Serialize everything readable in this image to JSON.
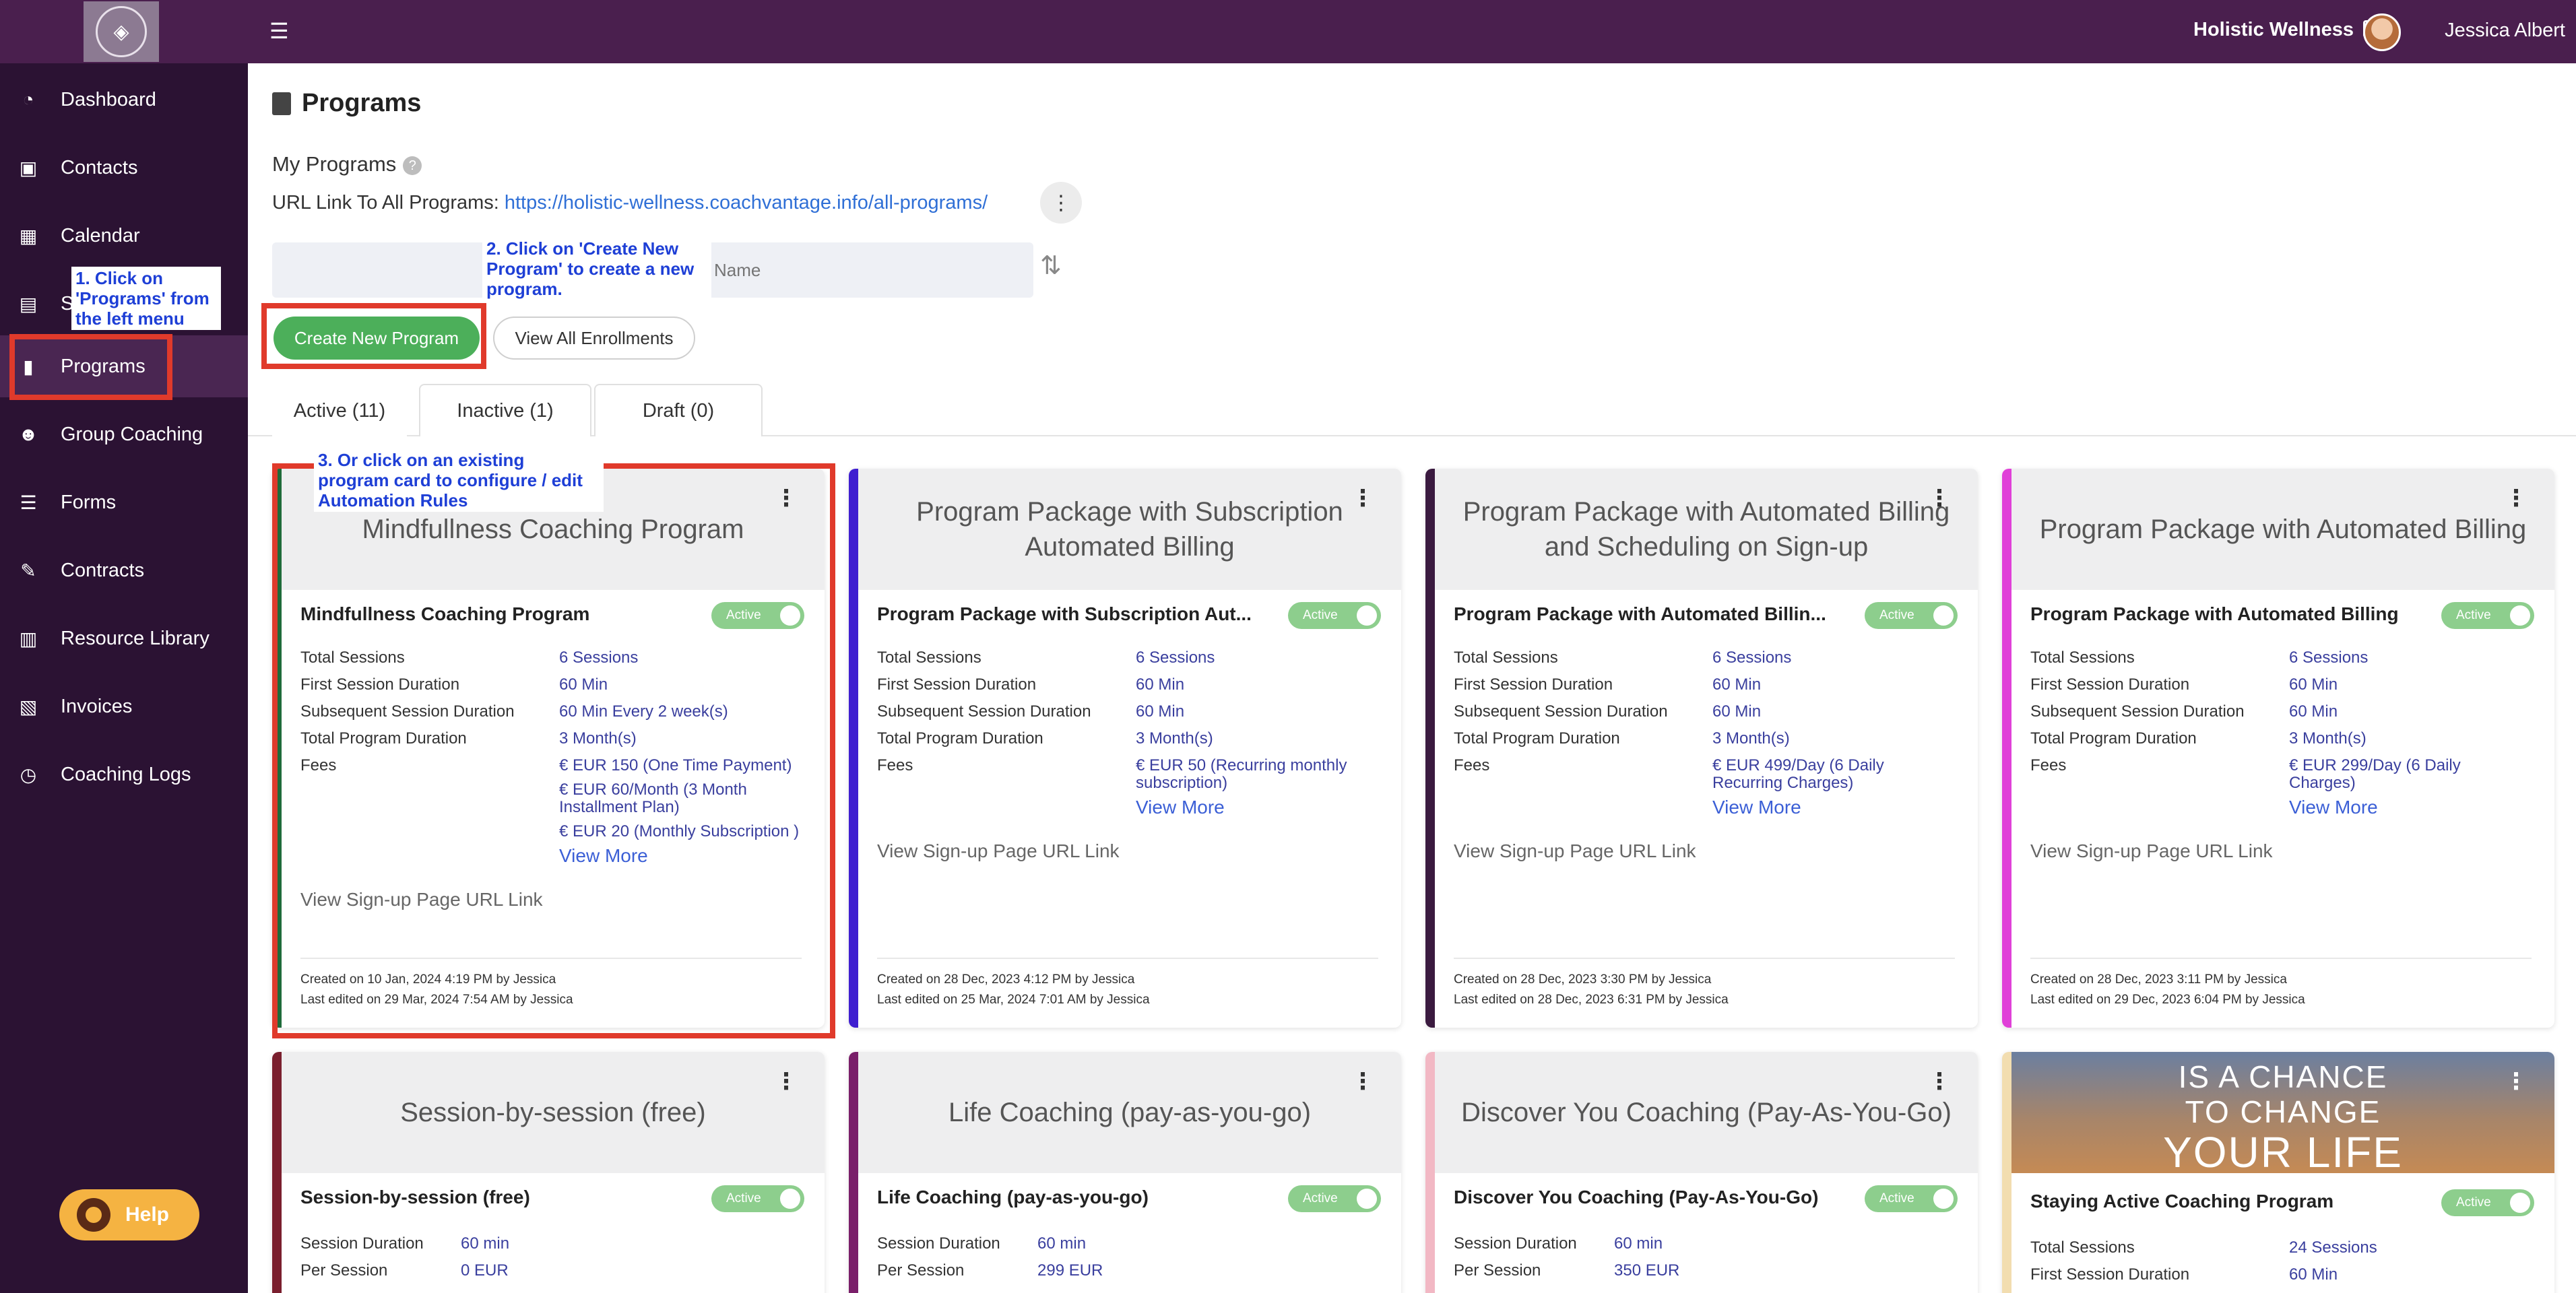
{
  "header": {
    "brand": "Holistic Wellness",
    "username": "Jessica Albert"
  },
  "sidebar": {
    "items": [
      {
        "label": "Dashboard",
        "icon": "dashboard-icon"
      },
      {
        "label": "Contacts",
        "icon": "contacts-icon"
      },
      {
        "label": "Calendar",
        "icon": "calendar-icon"
      },
      {
        "label": "Sc",
        "icon": "schedule-icon"
      },
      {
        "label": "Programs",
        "icon": "book-icon"
      },
      {
        "label": "Group Coaching",
        "icon": "group-icon"
      },
      {
        "label": "Forms",
        "icon": "forms-icon"
      },
      {
        "label": "Contracts",
        "icon": "contract-icon"
      },
      {
        "label": "Resource Library",
        "icon": "library-icon"
      },
      {
        "label": "Invoices",
        "icon": "invoice-icon"
      },
      {
        "label": "Coaching Logs",
        "icon": "clock-icon"
      }
    ],
    "help": "Help"
  },
  "annotations": {
    "a1": "1. Click on 'Programs' from the left menu",
    "a2": "2. Click on 'Create New Program' to create a new program.",
    "a3": "3. Or click on an existing program card to configure / edit Automation Rules"
  },
  "main": {
    "title": "Programs",
    "my_programs": "My Programs",
    "url_label": "URL Link To All Programs:",
    "url": "https://holistic-wellness.coachvantage.info/all-programs/",
    "name_placeholder": "Name",
    "create_button": "Create New Program",
    "enrollments_button": "View All Enrollments",
    "tabs": [
      {
        "label": "Active (11)"
      },
      {
        "label": "Inactive (1)"
      },
      {
        "label": "Draft (0)"
      }
    ]
  },
  "cards": [
    {
      "header": "Mindfullness Coaching Program",
      "subtitle": "Mindfullness Coaching Program",
      "status": "Active",
      "strip_color": "#1f6b3a",
      "rows": [
        {
          "k": "Total Sessions",
          "v": "6 Sessions"
        },
        {
          "k": "First Session Duration",
          "v": "60 Min"
        },
        {
          "k": "Subsequent Session Duration",
          "v": "60 Min Every 2 week(s)"
        },
        {
          "k": "Total Program Duration",
          "v": "3 Month(s)"
        }
      ],
      "fees_label": "Fees",
      "fees": [
        "€ EUR 150 (One Time Payment)",
        "€ EUR 60/Month (3 Month Installment Plan)",
        "€ EUR 20 (Monthly Subscription )"
      ],
      "view_more": "View More",
      "signup": "View Sign-up Page URL Link",
      "created": "Created on 10 Jan, 2024 4:19 PM by Jessica",
      "edited": "Last edited on 29 Mar, 2024 7:54 AM by Jessica"
    },
    {
      "header": "Program Package with Subscription Automated Billing",
      "subtitle": "Program Package with Subscription Aut...",
      "status": "Active",
      "strip_color": "#3f1fd0",
      "rows": [
        {
          "k": "Total Sessions",
          "v": "6 Sessions"
        },
        {
          "k": "First Session Duration",
          "v": "60 Min"
        },
        {
          "k": "Subsequent Session Duration",
          "v": "60 Min"
        },
        {
          "k": "Total Program Duration",
          "v": "3 Month(s)"
        }
      ],
      "fees_label": "Fees",
      "fees": [
        "€ EUR 50 (Recurring monthly subscription)"
      ],
      "view_more": "View More",
      "signup": "View Sign-up Page URL Link",
      "created": "Created on 28 Dec, 2023 4:12 PM by Jessica",
      "edited": "Last edited on 25 Mar, 2024 7:01 AM by Jessica"
    },
    {
      "header": "Program Package with Automated Billing and Scheduling on Sign-up",
      "subtitle": "Program Package with Automated Billin...",
      "status": "Active",
      "strip_color": "#3a1a3f",
      "rows": [
        {
          "k": "Total Sessions",
          "v": "6 Sessions"
        },
        {
          "k": "First Session Duration",
          "v": "60 Min"
        },
        {
          "k": "Subsequent Session Duration",
          "v": "60 Min"
        },
        {
          "k": "Total Program Duration",
          "v": "3 Month(s)"
        }
      ],
      "fees_label": "Fees",
      "fees": [
        "€ EUR 499/Day (6 Daily Recurring Charges)"
      ],
      "view_more": "View More",
      "signup": "View Sign-up Page URL Link",
      "created": "Created on 28 Dec, 2023 3:30 PM by Jessica",
      "edited": "Last edited on 28 Dec, 2023 6:31 PM by Jessica"
    },
    {
      "header": "Program Package with Automated Billing",
      "subtitle": "Program Package with Automated Billing",
      "status": "Active",
      "strip_color": "#e040d8",
      "rows": [
        {
          "k": "Total Sessions",
          "v": "6 Sessions"
        },
        {
          "k": "First Session Duration",
          "v": "60 Min"
        },
        {
          "k": "Subsequent Session Duration",
          "v": "60 Min"
        },
        {
          "k": "Total Program Duration",
          "v": "3 Month(s)"
        }
      ],
      "fees_label": "Fees",
      "fees": [
        "€ EUR 299/Day (6 Daily Charges)"
      ],
      "view_more": "View More",
      "signup": "View Sign-up Page URL Link",
      "created": "Created on 28 Dec, 2023 3:11 PM by Jessica",
      "edited": "Last edited on 29 Dec, 2023 6:04 PM by Jessica"
    }
  ],
  "cards2": [
    {
      "header": "Session-by-session (free)",
      "subtitle": "Session-by-session (free)",
      "status": "Active",
      "strip_color": "#7a1f2e",
      "rows": [
        {
          "k": "Session Duration",
          "v": "60 min"
        },
        {
          "k": "Per Session",
          "v": "0 EUR"
        }
      ]
    },
    {
      "header": "Life Coaching (pay-as-you-go)",
      "subtitle": "Life Coaching (pay-as-you-go)",
      "status": "Active",
      "strip_color": "#7a1f6a",
      "rows": [
        {
          "k": "Session Duration",
          "v": "60 min"
        },
        {
          "k": "Per Session",
          "v": "299 EUR"
        }
      ]
    },
    {
      "header": "Discover You Coaching (Pay-As-You-Go)",
      "subtitle": "Discover You Coaching (Pay-As-You-Go)",
      "status": "Active",
      "strip_color": "#f2b8c4",
      "rows": [
        {
          "k": "Session Duration",
          "v": "60 min"
        },
        {
          "k": "Per Session",
          "v": "350 EUR"
        }
      ]
    },
    {
      "banner": [
        "IS A CHANCE",
        "TO CHANGE",
        "YOUR LIFE"
      ],
      "subtitle": "Staying Active Coaching Program",
      "status": "Active",
      "strip_color": "#f2ddb0",
      "rows": [
        {
          "k": "Total Sessions",
          "v": "24 Sessions"
        },
        {
          "k": "First Session Duration",
          "v": "60 Min"
        }
      ]
    }
  ]
}
